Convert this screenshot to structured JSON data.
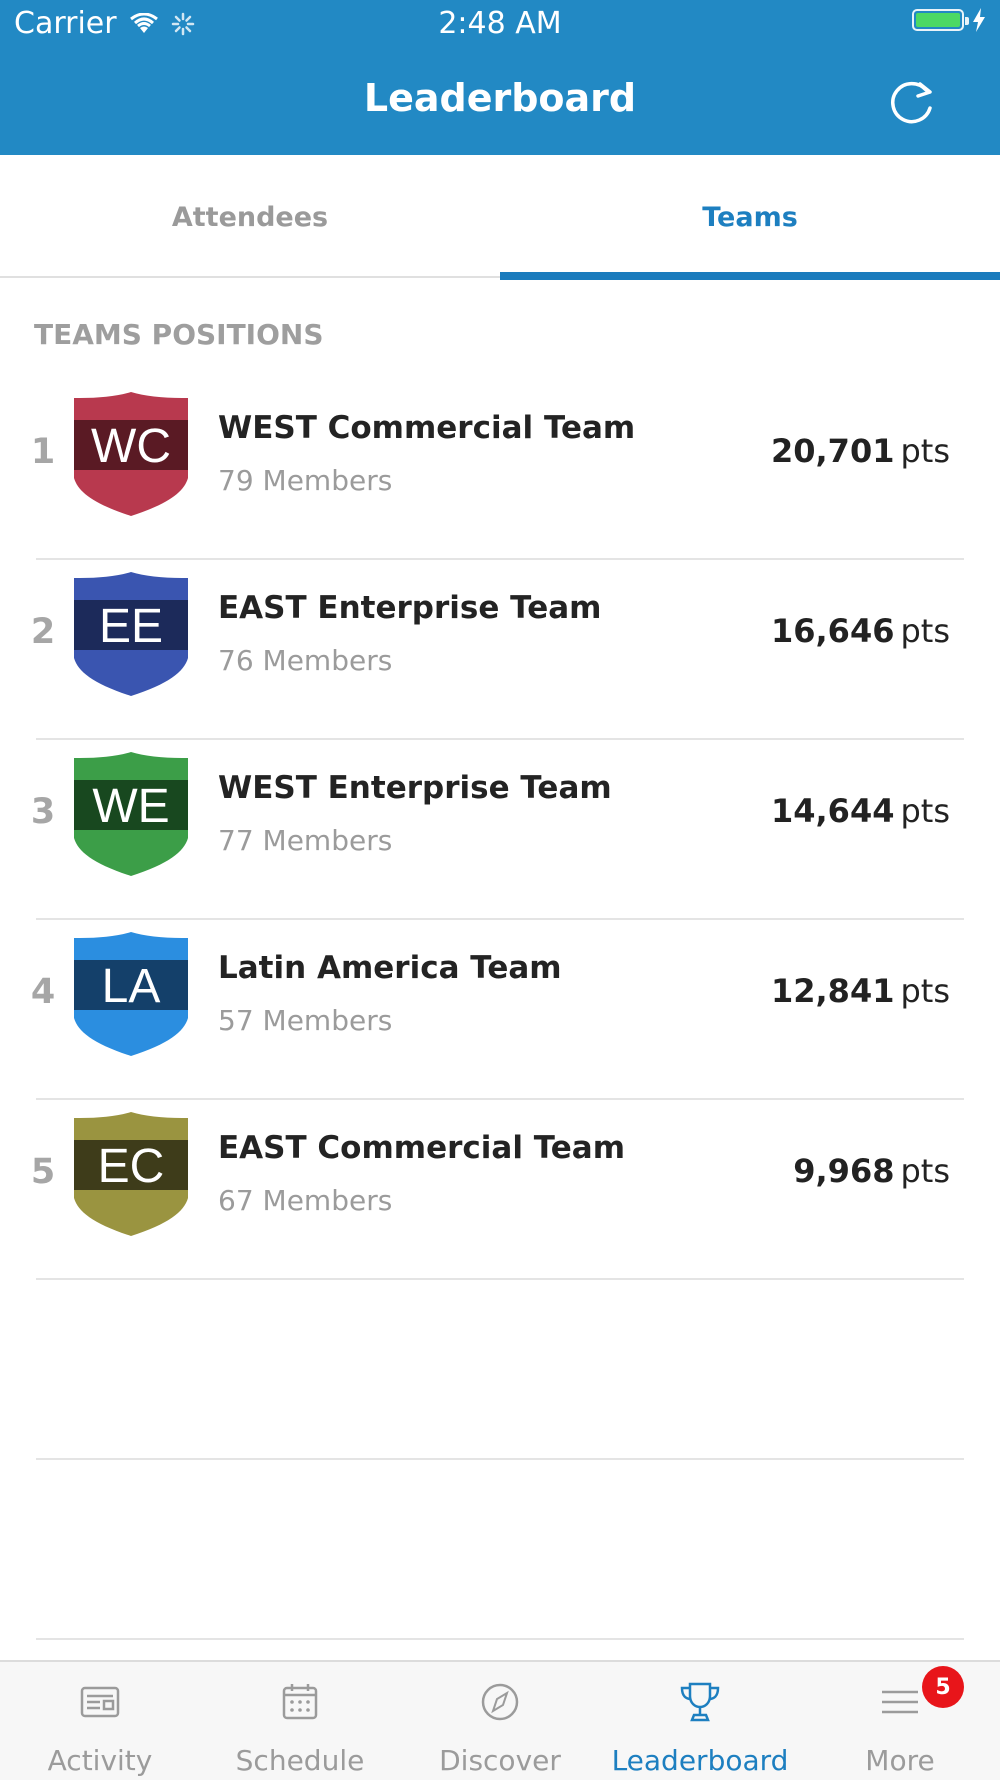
{
  "status_bar": {
    "carrier": "Carrier",
    "time": "2:48 AM"
  },
  "header": {
    "title": "Leaderboard"
  },
  "tabs": [
    {
      "label": "Attendees",
      "active": false
    },
    {
      "label": "Teams",
      "active": true
    }
  ],
  "section_title": "TEAMS POSITIONS",
  "teams": [
    {
      "rank": "1",
      "initials": "WC",
      "name": "WEST Commercial Team",
      "members": "79 Members",
      "points": "20,701",
      "unit": "pts",
      "colors": {
        "top": "#b8394e",
        "body": "#5a1a24",
        "stripe": "#b8394e"
      }
    },
    {
      "rank": "2",
      "initials": "EE",
      "name": "EAST Enterprise Team",
      "members": "76 Members",
      "points": "16,646",
      "unit": "pts",
      "colors": {
        "top": "#3a55b0",
        "body": "#1c2a5a",
        "stripe": "#3a55b0"
      }
    },
    {
      "rank": "3",
      "initials": "WE",
      "name": "WEST Enterprise Team",
      "members": "77 Members",
      "points": "14,644",
      "unit": "pts",
      "colors": {
        "top": "#3c9e48",
        "body": "#18481f",
        "stripe": "#3c9e48"
      }
    },
    {
      "rank": "4",
      "initials": "LA",
      "name": "Latin America Team",
      "members": "57 Members",
      "points": "12,841",
      "unit": "pts",
      "colors": {
        "top": "#2b8ee0",
        "body": "#14406a",
        "stripe": "#2b8ee0"
      }
    },
    {
      "rank": "5",
      "initials": "EC",
      "name": "EAST Commercial Team",
      "members": "67 Members",
      "points": "9,968",
      "unit": "pts",
      "colors": {
        "top": "#9a9440",
        "body": "#3e3c1a",
        "stripe": "#9a9440"
      }
    }
  ],
  "tab_bar": [
    {
      "label": "Activity",
      "icon": "activity-icon",
      "active": false
    },
    {
      "label": "Schedule",
      "icon": "calendar-icon",
      "active": false
    },
    {
      "label": "Discover",
      "icon": "compass-icon",
      "active": false
    },
    {
      "label": "Leaderboard",
      "icon": "trophy-icon",
      "active": true
    },
    {
      "label": "More",
      "icon": "menu-icon",
      "active": false,
      "badge": "5"
    }
  ],
  "theme": {
    "primary": "#2289c4",
    "accent": "#1a7bbd",
    "badge_red": "#e8151a"
  }
}
